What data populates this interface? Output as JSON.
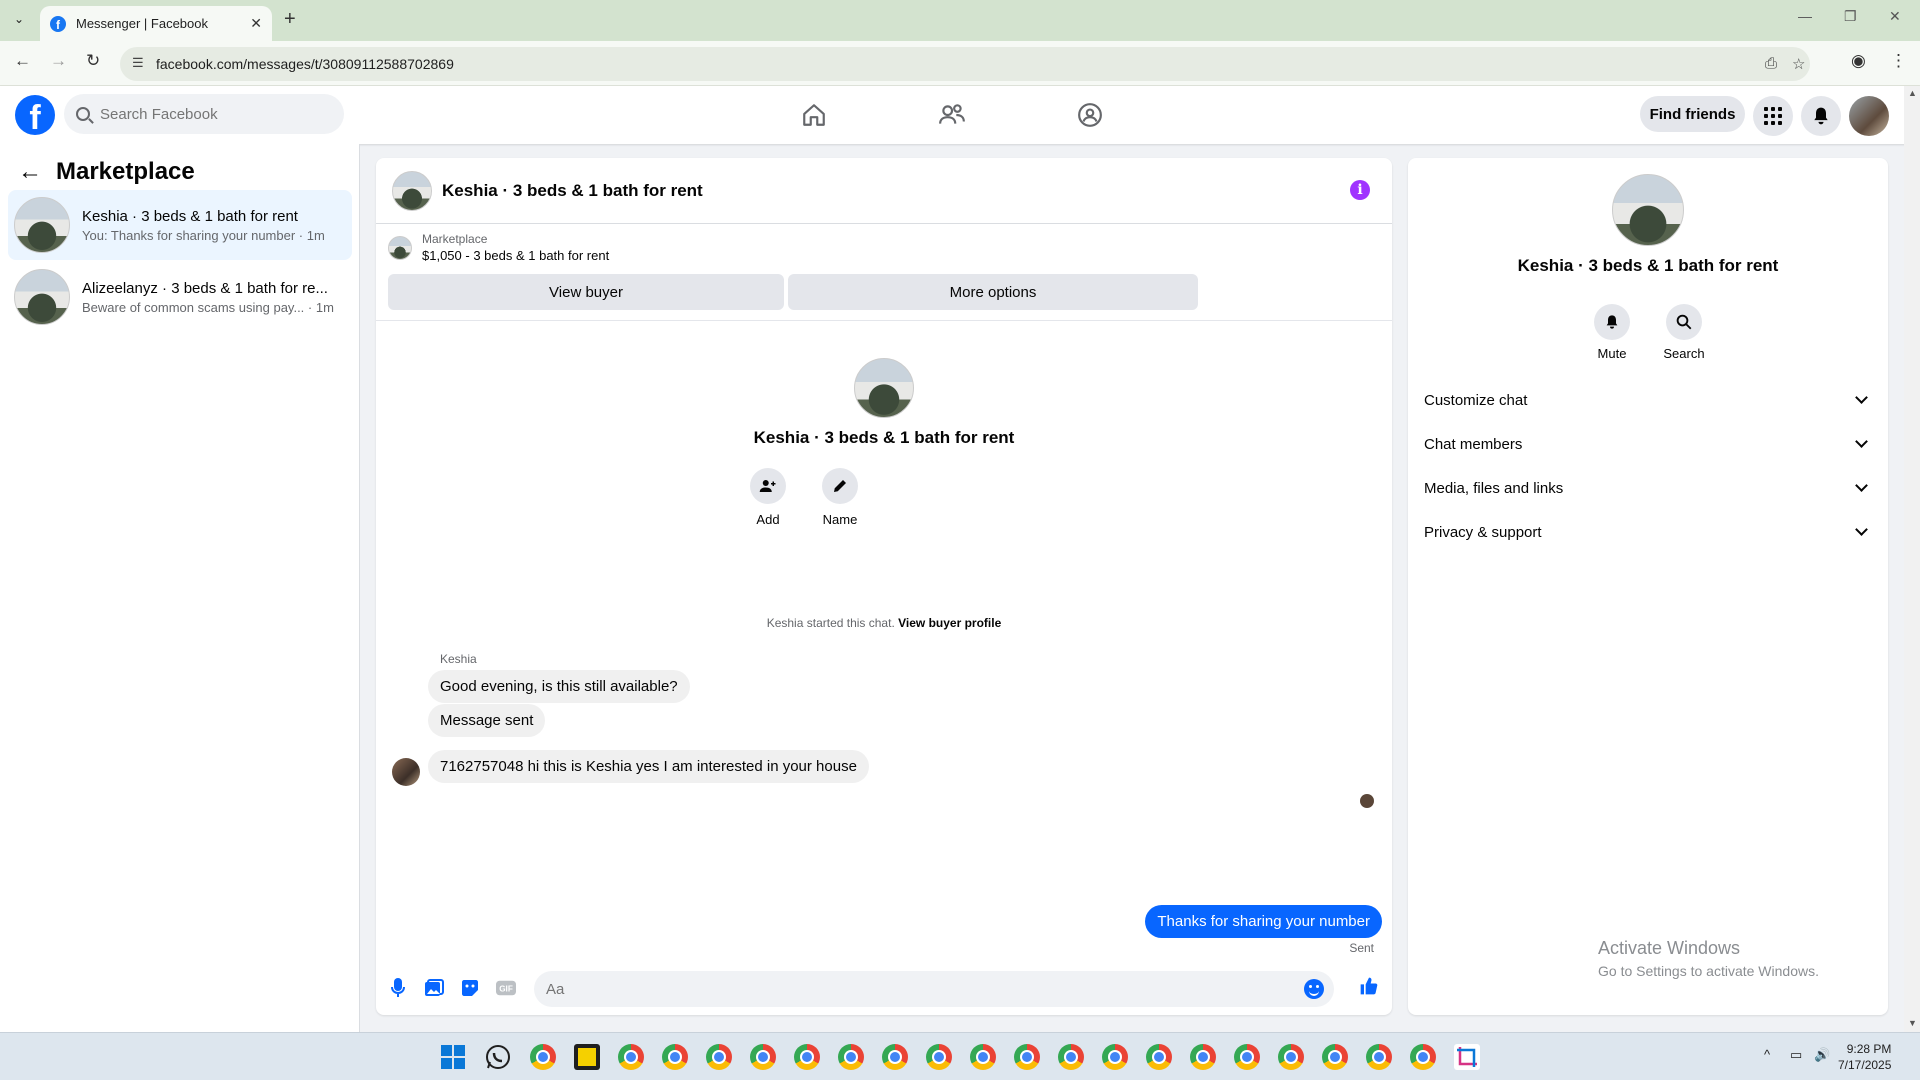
{
  "browser": {
    "tab_title": "Messenger | Facebook",
    "url": "facebook.com/messages/t/30809112588702869"
  },
  "header": {
    "search_placeholder": "Search Facebook",
    "find_friends": "Find friends"
  },
  "sidebar": {
    "title": "Marketplace",
    "conversations": [
      {
        "name": "Keshia · 3 beds & 1 bath for rent",
        "preview": "You: Thanks for sharing your number · 1m"
      },
      {
        "name": "Alizeelanyz · 3 beds & 1 bath for re...",
        "preview": "Beware of common scams using pay... · 1m"
      }
    ]
  },
  "chat": {
    "title": "Keshia · 3 beds & 1 bath for rent",
    "marketplace_label": "Marketplace",
    "listing": "$1,050 - 3 beds & 1 bath for rent",
    "view_buyer": "View buyer",
    "more_options": "More options",
    "intro_title": "Keshia · 3 beds & 1 bath for rent",
    "add_label": "Add",
    "name_label": "Name",
    "started_text": "Keshia started this chat.",
    "view_buyer_profile": "View buyer profile",
    "sender": "Keshia",
    "messages_in": [
      "Good evening, is this still available?",
      "Message sent",
      "7162757048 hi this is Keshia yes I am interested in your house"
    ],
    "message_out": "Thanks for sharing your number",
    "sent_status": "Sent",
    "composer_placeholder": "Aa"
  },
  "details": {
    "title": "Keshia · 3 beds & 1 bath for rent",
    "mute": "Mute",
    "search": "Search",
    "sections": [
      "Customize chat",
      "Chat members",
      "Media, files and links",
      "Privacy & support"
    ]
  },
  "watermark": {
    "line1": "Activate Windows",
    "line2": "Go to Settings to activate Windows."
  },
  "taskbar": {
    "time": "9:28 PM",
    "date": "7/17/2025"
  },
  "colors": {
    "accent": "#0866ff",
    "info": "#a033ff"
  }
}
